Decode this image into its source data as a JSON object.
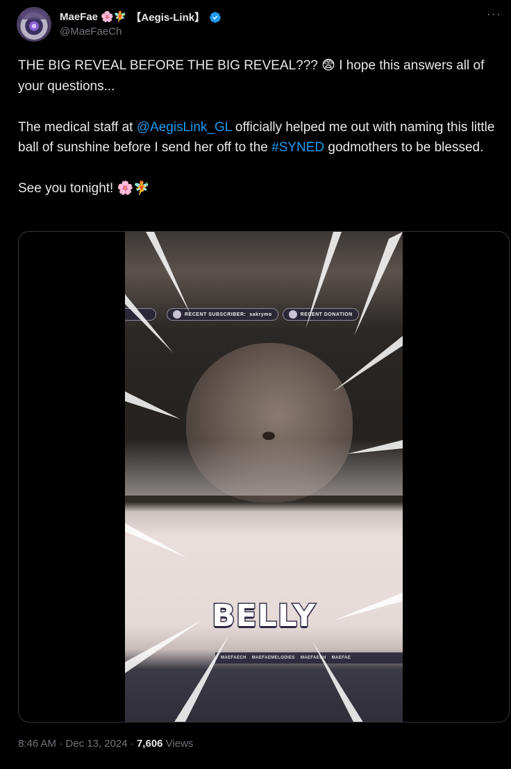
{
  "author": {
    "display_name": "MaeFae",
    "name_emojis": "🌸🧚",
    "affiliation": "【Aegis-Link】",
    "handle": "@MaeFaeCh",
    "verified": true,
    "avatar_icon": "avatar-icon"
  },
  "more_label": "···",
  "tweet": {
    "line1": "THE BIG REVEAL BEFORE THE BIG REVEAL??? 😨 I hope this answers all of your questions...",
    "p2_pre": "The medical staff at ",
    "p2_mention": "@AegisLink_GL",
    "p2_mid": " officially helped me out with naming this little ball of sunshine before I send her off to the ",
    "p2_hashtag": "#SYNED",
    "p2_post": " godmothers to be blessed.",
    "p3": "See you tonight! 🌸🧚"
  },
  "media": {
    "recent_subscriber_label": "RECENT SUBSCRIBER:",
    "recent_subscriber_name": "sakrymo",
    "recent_donation_label": "RECENT DONATION",
    "caption": "BELLY",
    "social_1": "MAEFAECH",
    "social_2": "MAEFAEMELODIES",
    "social_3": "MAEFAECH",
    "social_4": "MAEFAE"
  },
  "meta": {
    "time": "8:46 AM",
    "sep1": " · ",
    "date": "Dec 13, 2024",
    "sep2": " · ",
    "views": "7,606",
    "views_label": " Views"
  },
  "colors": {
    "background": "#000000",
    "text": "#e7e9ea",
    "muted": "#71767b",
    "link": "#1d9bf0",
    "verified": "#1d9bf0"
  }
}
